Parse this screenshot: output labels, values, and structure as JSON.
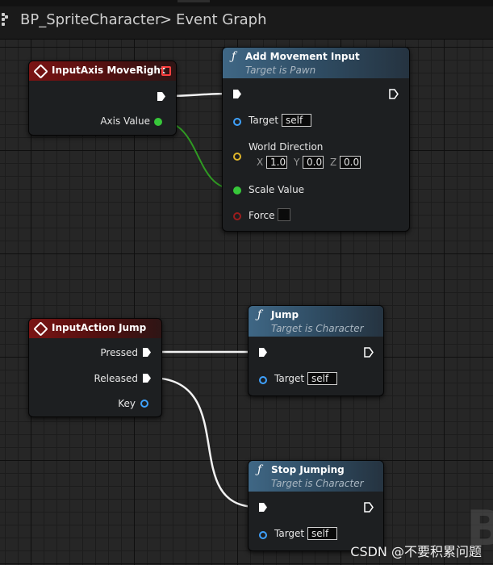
{
  "breadcrumb": {
    "blueprint": "BP_SpriteCharacter",
    "separator": ">",
    "graph": "Event Graph"
  },
  "colors": {
    "event_header": "#7a1414",
    "function_header": "#3f6785",
    "exec_pin": "#ffffff",
    "float_pin": "#37c73a",
    "object_pin": "#3fa2ff",
    "vector_pin": "#e0b52a",
    "bool_pin": "#9c1d1d"
  },
  "nodes": {
    "move_right_event": {
      "title": "InputAxis MoveRight",
      "axis_value_label": "Axis Value"
    },
    "add_movement": {
      "title": "Add Movement Input",
      "subtitle": "Target is Pawn",
      "target_label": "Target",
      "target_value": "self",
      "direction_label": "World Direction",
      "x_label": "X",
      "x_value": "1.0",
      "y_label": "Y",
      "y_value": "0.0",
      "z_label": "Z",
      "z_value": "0.0",
      "scale_label": "Scale Value",
      "force_label": "Force"
    },
    "jump_event": {
      "title": "InputAction Jump",
      "pressed_label": "Pressed",
      "released_label": "Released",
      "key_label": "Key"
    },
    "jump_fn": {
      "title": "Jump",
      "subtitle": "Target is Character",
      "target_label": "Target",
      "target_value": "self"
    },
    "stop_jumping_fn": {
      "title": "Stop Jumping",
      "subtitle": "Target is Character",
      "target_label": "Target",
      "target_value": "self"
    }
  },
  "watermark": "CSDN @不要积累问题",
  "corner_letter": "B"
}
